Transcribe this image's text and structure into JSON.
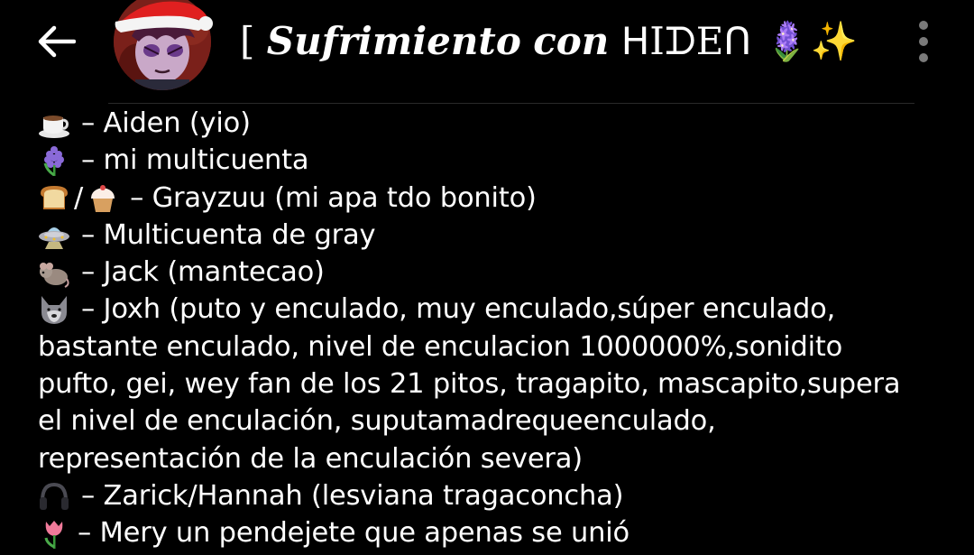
{
  "header": {
    "back_icon": "arrow-left-icon",
    "avatar_icon": "santa-hat-avatar",
    "title_open": "[ ",
    "title_sufrimiento": "Sufrimiento",
    "title_con": "con",
    "title_name": "ᕼIᗪEᑎ",
    "title_tail_emoji": "🪻✨",
    "title_close": " ]...",
    "menu_icon": "more-vertical-icon"
  },
  "message": {
    "lines": [
      {
        "icon": "coffee-icon",
        "text": "– Aiden (yio)"
      },
      {
        "icon": "hyacinth-icon",
        "text": "– mi multicuenta"
      },
      {
        "icon": "bread-cupcake-icon",
        "slash": "/",
        "text": "– Grayzuu (mi apa tdo bonito)"
      },
      {
        "icon": "ufo-icon",
        "text": "– Multicuenta de gray"
      },
      {
        "icon": "rat-icon",
        "text": "– Jack (mantecao)"
      },
      {
        "icon": "wolf-icon",
        "text": "– Joxh (puto y enculado, muy enculado,súper enculado,"
      },
      {
        "icon": "",
        "text": "bastante enculado, nivel de enculacion 1000000%,sonidito"
      },
      {
        "icon": "",
        "text": "pufto, gei, wey fan de los 21 pitos, tragapito, mascapito,supera"
      },
      {
        "icon": "",
        "text": "el nivel de enculación, suputamadrequeenculado,"
      },
      {
        "icon": "",
        "text": "representación de la enculación severa)"
      },
      {
        "icon": "headphones-icon",
        "text": "– Zarick/Hannah (lesviana tragaconcha)"
      },
      {
        "icon": "tulip-icon",
        "text": "– Mery un pendejete que apenas se unió"
      }
    ]
  },
  "colors": {
    "background": "#000000",
    "text": "#ffffff",
    "menu_dots": "#7a7a7a",
    "divider": "#2a2a2a"
  }
}
